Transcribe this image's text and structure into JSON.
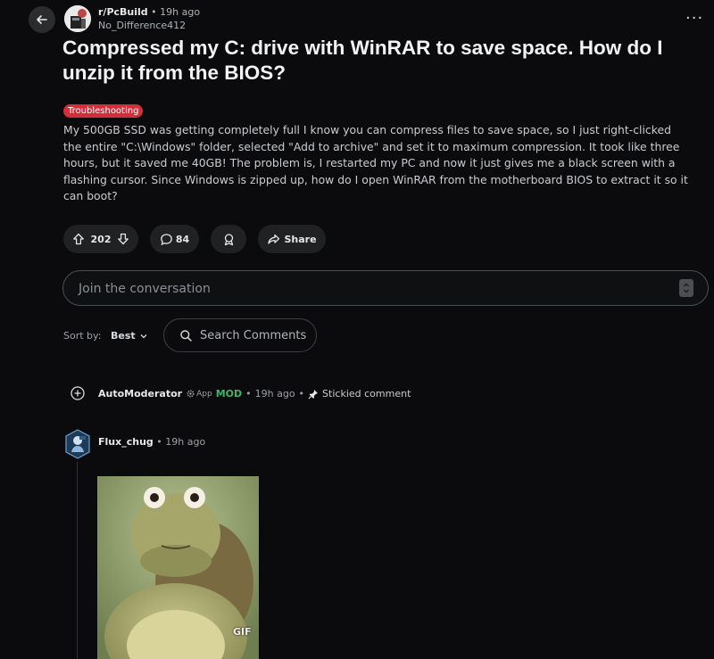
{
  "header": {
    "subreddit": "r/PcBuild",
    "time": "19h ago",
    "username": "No_Difference412",
    "more_label": "···"
  },
  "post": {
    "title": "Compressed my C: drive with WinRAR to save space. How do I unzip it from the BIOS?",
    "flair": "Troubleshooting",
    "flair_color": "#d42e3a",
    "body": "My 500GB SSD was getting completely full I know you can compress files to save space, so I just right-clicked the entire \"C:\\Windows\" folder, selected \"Add to archive\" and set it to maximum compression. It took like three hours, but it saved me 40GB! The problem is, I restarted my PC and now it just gives me a black screen with a flashing cursor. Since Windows is zipped up, how do I open WinRAR from the motherboard BIOS to extract it so it can boot?"
  },
  "actions": {
    "votes": "202",
    "comments": "84",
    "share_label": "Share"
  },
  "composer": {
    "placeholder": "Join the conversation"
  },
  "sort": {
    "label": "Sort by:",
    "value": "Best",
    "search_placeholder": "Search Comments"
  },
  "comments": [
    {
      "author": "AutoModerator",
      "app_label": "App",
      "mod_badge": "MOD",
      "time": "19h ago",
      "stickied_label": "Stickied comment",
      "separator": "•"
    },
    {
      "author": "Flux_chug",
      "time": "19h ago",
      "separator": "•",
      "media_label": "GIF"
    }
  ],
  "icons": {
    "back": "arrow-left-icon",
    "upvote": "arrow-up-icon",
    "downvote": "arrow-down-icon",
    "comment": "speech-bubble-icon",
    "award": "award-icon",
    "share": "share-arrow-icon",
    "search": "magnifier-icon",
    "expand": "plus-circle-icon",
    "pin": "pin-icon"
  },
  "colors": {
    "mod": "#3fb56b",
    "background": "#0b0b0d"
  }
}
